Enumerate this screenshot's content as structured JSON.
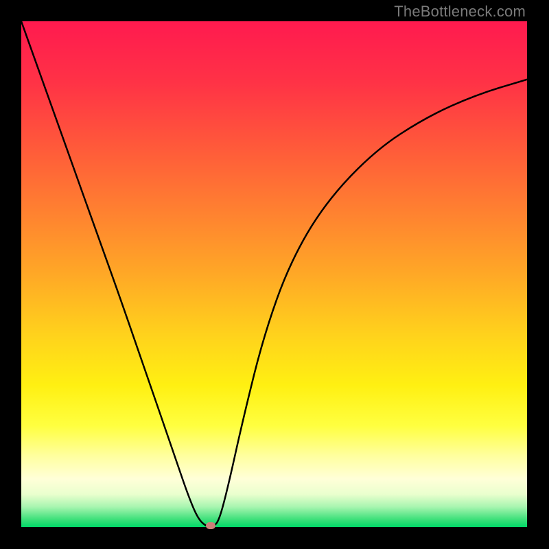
{
  "watermark": "TheBottleneck.com",
  "chart_data": {
    "type": "line",
    "title": "",
    "xlabel": "",
    "ylabel": "",
    "xlim": [
      0,
      1
    ],
    "ylim": [
      0,
      1
    ],
    "background_gradient_stops": [
      {
        "offset": 0.0,
        "color": "#ff1a4f"
      },
      {
        "offset": 0.12,
        "color": "#ff3246"
      },
      {
        "offset": 0.25,
        "color": "#ff5a3a"
      },
      {
        "offset": 0.38,
        "color": "#ff8230"
      },
      {
        "offset": 0.5,
        "color": "#ffa826"
      },
      {
        "offset": 0.62,
        "color": "#ffd21c"
      },
      {
        "offset": 0.72,
        "color": "#fff012"
      },
      {
        "offset": 0.8,
        "color": "#ffff40"
      },
      {
        "offset": 0.86,
        "color": "#ffffa0"
      },
      {
        "offset": 0.905,
        "color": "#ffffd8"
      },
      {
        "offset": 0.935,
        "color": "#eaffce"
      },
      {
        "offset": 0.96,
        "color": "#a8f5b0"
      },
      {
        "offset": 0.985,
        "color": "#3de07a"
      },
      {
        "offset": 1.0,
        "color": "#00d968"
      }
    ],
    "series": [
      {
        "name": "bottleneck-curve",
        "x": [
          0.0,
          0.05,
          0.1,
          0.15,
          0.2,
          0.25,
          0.3,
          0.33,
          0.35,
          0.368,
          0.38,
          0.392,
          0.41,
          0.44,
          0.48,
          0.53,
          0.6,
          0.7,
          0.8,
          0.9,
          1.0
        ],
        "y": [
          1.0,
          0.86,
          0.72,
          0.58,
          0.44,
          0.295,
          0.15,
          0.062,
          0.015,
          0.0,
          0.0,
          0.015,
          0.085,
          0.22,
          0.38,
          0.52,
          0.64,
          0.745,
          0.81,
          0.855,
          0.885
        ]
      }
    ],
    "marker": {
      "x": 0.375,
      "y": 0.003,
      "color": "#cc8079"
    },
    "curve_stroke": {
      "color": "#000000",
      "width": 2.5
    }
  }
}
